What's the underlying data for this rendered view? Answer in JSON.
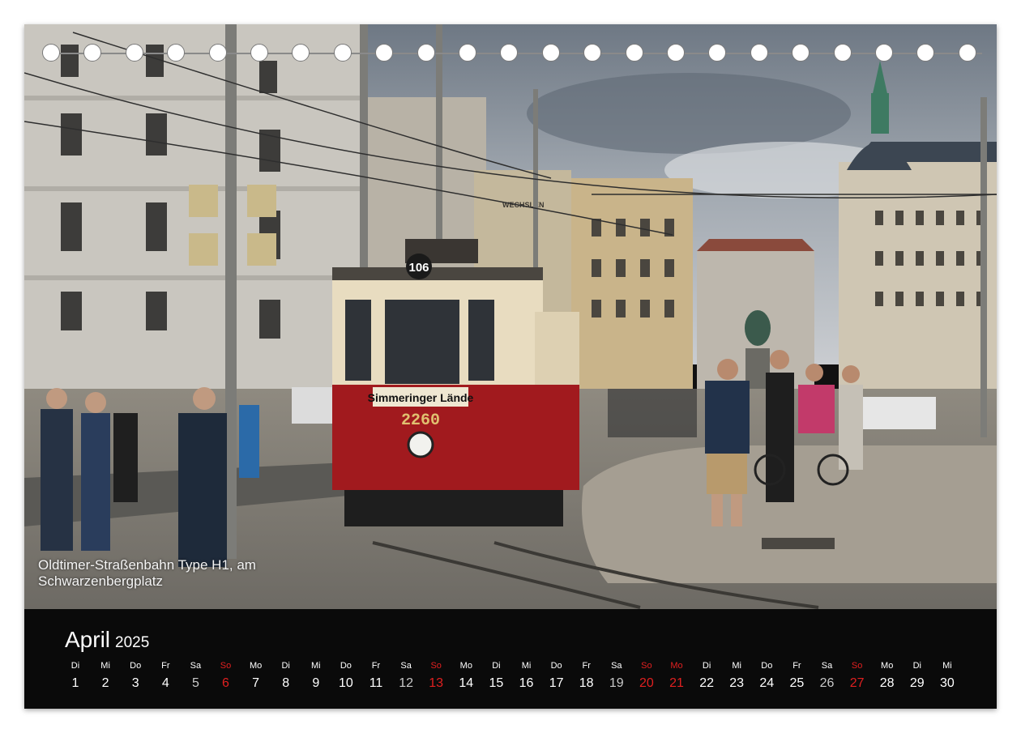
{
  "photo": {
    "caption_line1": "Oldtimer-Straßenbahn Type H1, am",
    "caption_line2": "Schwarzenbergplatz",
    "tram_number": "106",
    "tram_destination": "Simmeringer Lände",
    "tram_fleet_number": "2260",
    "shop_sign": "WECHSLEN",
    "colors": {
      "tram_red": "#a11a1e",
      "tram_cream": "#e8dcc0",
      "sky": "#8e98a4"
    }
  },
  "calendar": {
    "month": "April",
    "year": "2025",
    "days": [
      {
        "wd": "Di",
        "d": "1",
        "t": "n"
      },
      {
        "wd": "Mi",
        "d": "2",
        "t": "n"
      },
      {
        "wd": "Do",
        "d": "3",
        "t": "n"
      },
      {
        "wd": "Fr",
        "d": "4",
        "t": "n"
      },
      {
        "wd": "Sa",
        "d": "5",
        "t": "sat"
      },
      {
        "wd": "So",
        "d": "6",
        "t": "red"
      },
      {
        "wd": "Mo",
        "d": "7",
        "t": "n"
      },
      {
        "wd": "Di",
        "d": "8",
        "t": "n"
      },
      {
        "wd": "Mi",
        "d": "9",
        "t": "n"
      },
      {
        "wd": "Do",
        "d": "10",
        "t": "n"
      },
      {
        "wd": "Fr",
        "d": "11",
        "t": "n"
      },
      {
        "wd": "Sa",
        "d": "12",
        "t": "sat"
      },
      {
        "wd": "So",
        "d": "13",
        "t": "red"
      },
      {
        "wd": "Mo",
        "d": "14",
        "t": "n"
      },
      {
        "wd": "Di",
        "d": "15",
        "t": "n"
      },
      {
        "wd": "Mi",
        "d": "16",
        "t": "n"
      },
      {
        "wd": "Do",
        "d": "17",
        "t": "n"
      },
      {
        "wd": "Fr",
        "d": "18",
        "t": "n"
      },
      {
        "wd": "Sa",
        "d": "19",
        "t": "sat"
      },
      {
        "wd": "So",
        "d": "20",
        "t": "red"
      },
      {
        "wd": "Mo",
        "d": "21",
        "t": "red"
      },
      {
        "wd": "Di",
        "d": "22",
        "t": "n"
      },
      {
        "wd": "Mi",
        "d": "23",
        "t": "n"
      },
      {
        "wd": "Do",
        "d": "24",
        "t": "n"
      },
      {
        "wd": "Fr",
        "d": "25",
        "t": "n"
      },
      {
        "wd": "Sa",
        "d": "26",
        "t": "sat"
      },
      {
        "wd": "So",
        "d": "27",
        "t": "red"
      },
      {
        "wd": "Mo",
        "d": "28",
        "t": "n"
      },
      {
        "wd": "Di",
        "d": "29",
        "t": "n"
      },
      {
        "wd": "Mi",
        "d": "30",
        "t": "n"
      }
    ],
    "colors": {
      "weekend_red": "#e02020",
      "background": "#0a0a0a"
    }
  }
}
